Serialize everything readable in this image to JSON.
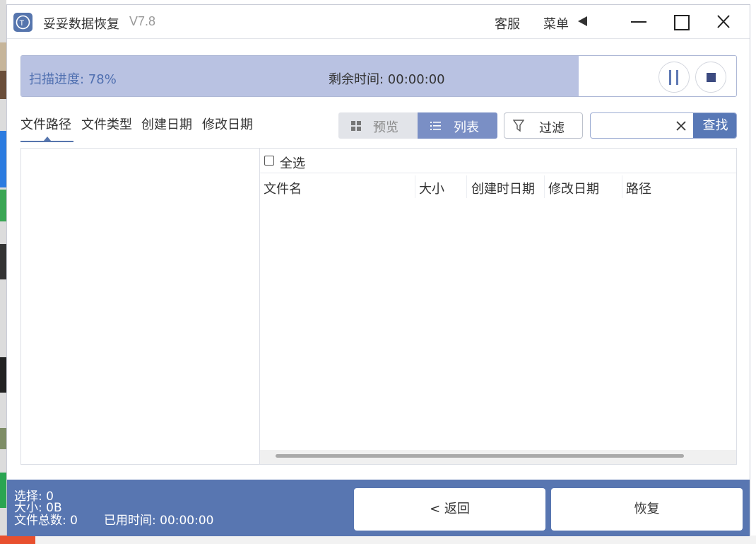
{
  "app": {
    "title": "妥妥数据恢复",
    "version": "V7.8",
    "logo_text": "T",
    "service_label": "客服",
    "menu_label": "菜单"
  },
  "scan": {
    "progress_label": "扫描进度: 78%",
    "progress_fraction": 0.78,
    "remaining_label": "剩余时间: 00:00:00"
  },
  "tabs": [
    {
      "label": "文件路径"
    },
    {
      "label": "文件类型"
    },
    {
      "label": "创建日期"
    },
    {
      "label": "修改日期"
    }
  ],
  "toolbar": {
    "preview_label": "预览",
    "list_label": "列表",
    "filter_label": "过滤",
    "search_value": "",
    "search_button": "查找"
  },
  "list": {
    "select_all_label": "全选",
    "columns": [
      "文件名",
      "大小",
      "创建时日期",
      "修改日期",
      "路径"
    ]
  },
  "footer": {
    "selected": "选择: 0",
    "size": "大小: 0B",
    "total": "文件总数: 0",
    "elapsed": "已用时间: 00:00:00",
    "back_button": "< 返回",
    "recover_button": "恢复"
  },
  "colors": {
    "accent": "#5876b1",
    "progress_fill": "#b9c2e2",
    "list_toggle_active": "#7a8fc5"
  }
}
